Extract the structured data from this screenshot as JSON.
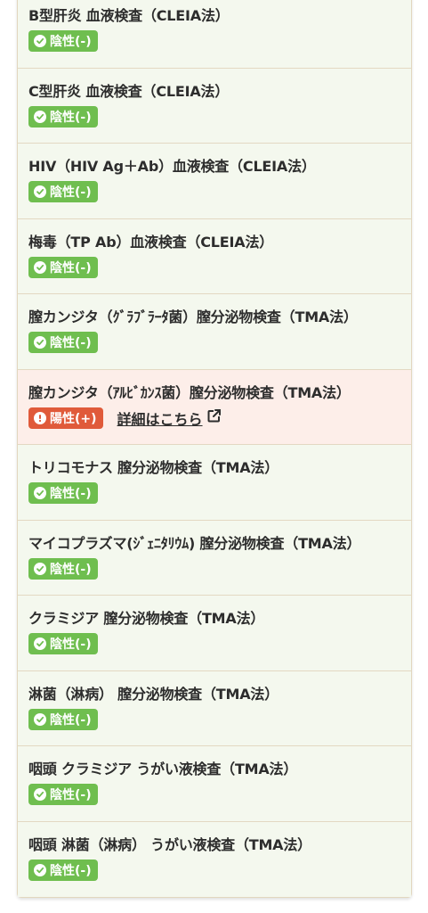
{
  "results": [
    {
      "title": "B型肝炎 血液検査（CLEIA法）",
      "status": "陰性(-)",
      "result": "negative"
    },
    {
      "title": "C型肝炎 血液検査（CLEIA法）",
      "status": "陰性(-)",
      "result": "negative"
    },
    {
      "title": "HIV（HIV Ag＋Ab）血液検査（CLEIA法）",
      "status": "陰性(-)",
      "result": "negative"
    },
    {
      "title": "梅毒（TP Ab）血液検査（CLEIA法）",
      "status": "陰性(-)",
      "result": "negative"
    },
    {
      "title": "膣カンジタ（ｸﾞﾗﾌﾞﾗｰﾀ菌）膣分泌物検査（TMA法）",
      "status": "陰性(-)",
      "result": "negative"
    },
    {
      "title": "膣カンジタ（ｱﾙﾋﾞｶﾝｽ菌）膣分泌物検査（TMA法）",
      "status": "陽性(+)",
      "result": "positive",
      "detail_link": "詳細はこちら"
    },
    {
      "title": "トリコモナス 膣分泌物検査（TMA法）",
      "status": "陰性(-)",
      "result": "negative"
    },
    {
      "title": "マイコプラズマ(ｼﾞｪﾆﾀﾘｳﾑ) 膣分泌物検査（TMA法）",
      "status": "陰性(-)",
      "result": "negative"
    },
    {
      "title": "クラミジア 膣分泌物検査（TMA法）",
      "status": "陰性(-)",
      "result": "negative"
    },
    {
      "title": "淋菌（淋病） 膣分泌物検査（TMA法）",
      "status": "陰性(-)",
      "result": "negative"
    },
    {
      "title": "咽頭 クラミジア うがい液検査（TMA法）",
      "status": "陰性(-)",
      "result": "negative"
    },
    {
      "title": "咽頭 淋菌（淋病） うがい液検査（TMA法）",
      "status": "陰性(-)",
      "result": "negative"
    }
  ],
  "colors": {
    "negative_badge": "#6fbe4f",
    "positive_badge": "#e05a3a",
    "row_background": "#f4f8ee",
    "positive_row_background": "#fdeee9"
  },
  "icons": {
    "negative": "check-circle-icon",
    "positive": "exclamation-circle-icon",
    "detail_link": "external-link-icon"
  }
}
